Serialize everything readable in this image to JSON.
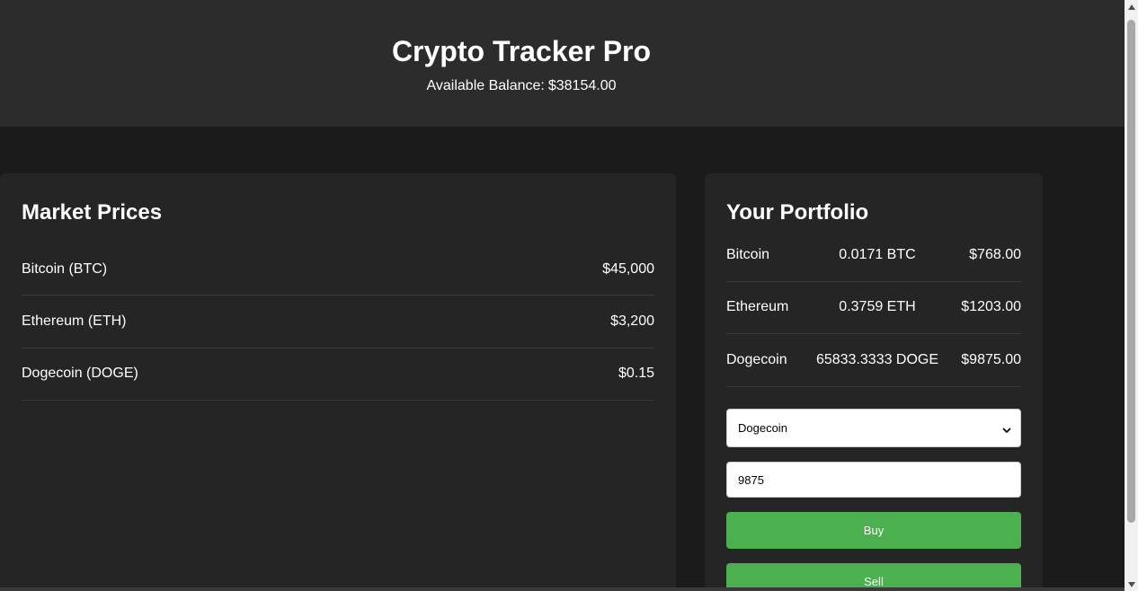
{
  "header": {
    "title": "Crypto Tracker Pro",
    "balance_label": "Available Balance:",
    "balance_value": "$38154.00"
  },
  "market": {
    "title": "Market Prices",
    "items": [
      {
        "name": "Bitcoin (BTC)",
        "price": "$45,000"
      },
      {
        "name": "Ethereum (ETH)",
        "price": "$3,200"
      },
      {
        "name": "Dogecoin (DOGE)",
        "price": "$0.15"
      }
    ]
  },
  "portfolio": {
    "title": "Your Portfolio",
    "holdings": [
      {
        "name": "Bitcoin",
        "amount": "0.0171 BTC",
        "value": "$768.00"
      },
      {
        "name": "Ethereum",
        "amount": "0.3759 ETH",
        "value": "$1203.00"
      },
      {
        "name": "Dogecoin",
        "amount": "65833.3333 DOGE",
        "value": "$9875.00"
      }
    ],
    "select": {
      "selected": "Dogecoin"
    },
    "amount_input": {
      "value": "9875"
    },
    "buy_label": "Buy",
    "sell_label": "Sell"
  },
  "colors": {
    "background": "#1b1b1b",
    "header": "#2c2c2c",
    "panel": "#252525",
    "accent_green": "#4caf50"
  },
  "icons": {
    "select_arrow": "chevron-down-icon",
    "scroll_up": "scroll-up-arrow-icon",
    "scroll_down": "scroll-down-arrow-icon"
  }
}
